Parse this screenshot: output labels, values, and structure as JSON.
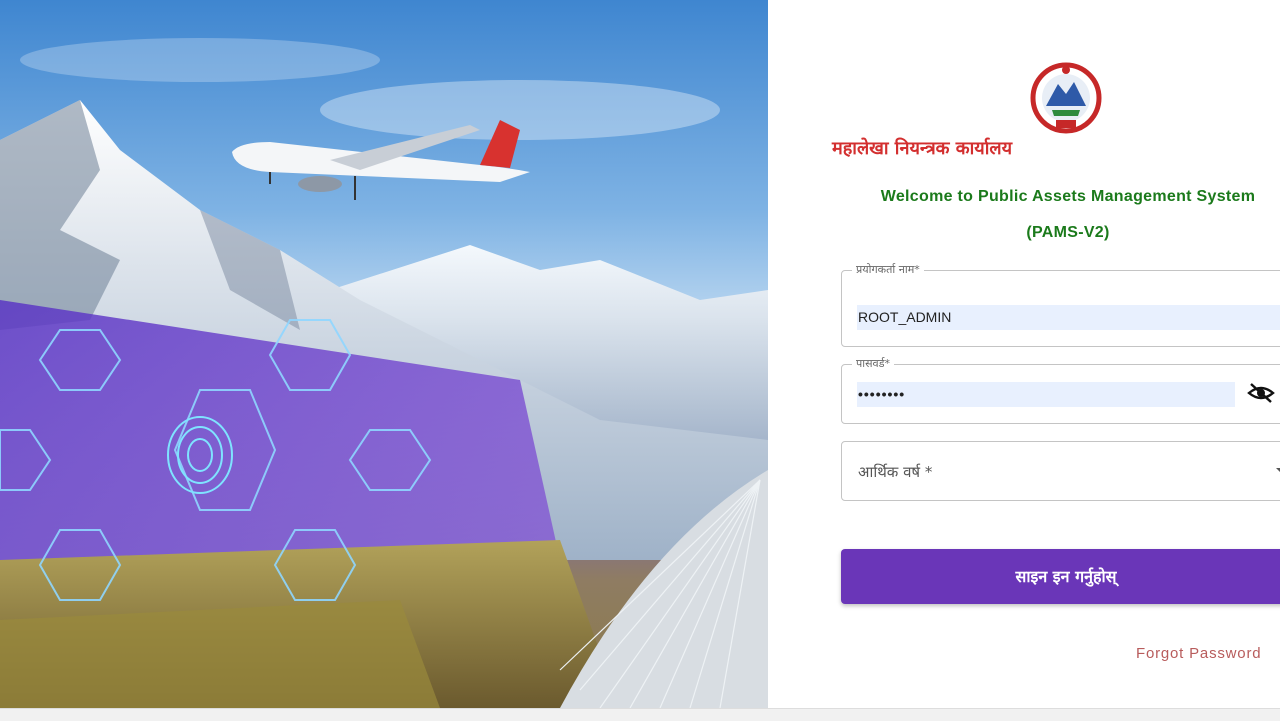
{
  "office": {
    "name": "महालेखा नियन्त्रक कार्यालय"
  },
  "welcome": {
    "line1": "Welcome to Public Assets Management System",
    "line2": "(PAMS-V2)"
  },
  "form": {
    "username": {
      "label": "प्रयोगकर्ता नाम",
      "value": "ROOT_ADMIN"
    },
    "password": {
      "label": "पासवर्ड",
      "value": "••••••••"
    },
    "fiscal_year": {
      "label": "आर्थिक वर्ष *"
    },
    "required_mark": "*"
  },
  "actions": {
    "signin_label": "साइन इन गर्नुहोस्",
    "forgot_label": "Forgot Password"
  },
  "colors": {
    "brand": "#6a36b8",
    "title_red": "#d32f2f",
    "welcome_green": "#1b7a1b"
  }
}
